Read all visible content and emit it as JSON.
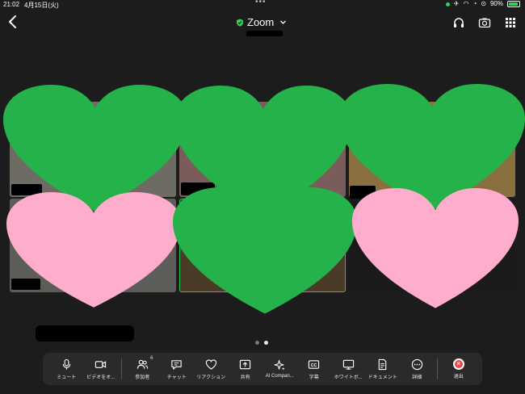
{
  "status_bar": {
    "time": "21:02",
    "date": "4月15日(火)",
    "battery": "90%"
  },
  "header": {
    "title": "Zoom"
  },
  "colors": {
    "heart_green": "#26b24b",
    "heart_pink": "#ffadcc",
    "active_border": "#25c855",
    "leave_red": "#ef4444",
    "toolbar_bg": "#2a2a2a"
  },
  "toolbar": {
    "items": [
      {
        "icon": "microphone-icon",
        "label": "ミュート"
      },
      {
        "icon": "video-camera-icon",
        "label": "ビデオをオ..."
      },
      {
        "icon": "participants-icon",
        "label": "参加者",
        "badge": "6"
      },
      {
        "icon": "chat-icon",
        "label": "チャット"
      },
      {
        "icon": "reaction-heart-icon",
        "label": "リアクション"
      },
      {
        "icon": "share-icon",
        "label": "共有"
      },
      {
        "icon": "ai-sparkle-icon",
        "label": "AI Compan..."
      },
      {
        "icon": "captions-icon",
        "label": "字幕"
      },
      {
        "icon": "whiteboard-icon",
        "label": "ホワイトボ..."
      },
      {
        "icon": "document-icon",
        "label": "ドキュメント"
      },
      {
        "icon": "more-icon",
        "label": "詳細"
      },
      {
        "icon": "leave-icon",
        "label": "退出"
      }
    ]
  }
}
